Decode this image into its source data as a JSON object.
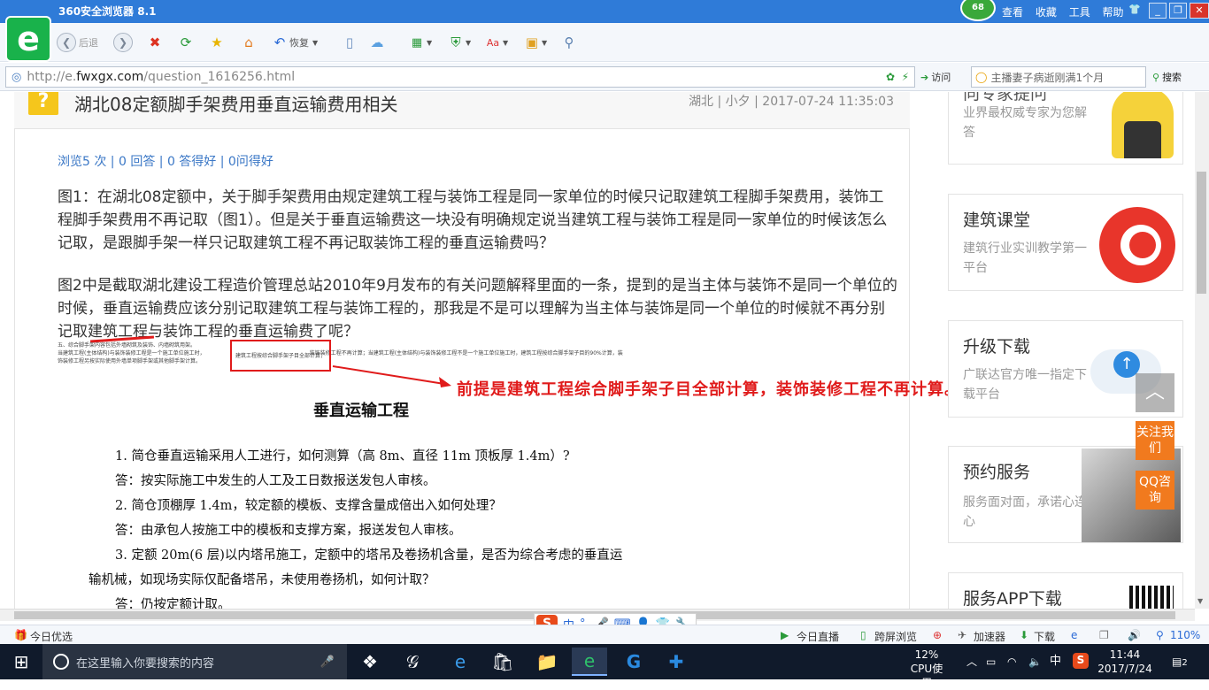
{
  "browser": {
    "title": "360安全浏览器 8.1",
    "score": "68",
    "menus": [
      "查看",
      "收藏",
      "工具",
      "帮助"
    ],
    "back_label": "后退",
    "restore_label": "恢复",
    "url_prefix": "http://e.",
    "url_domain": "fwxgx.com",
    "url_path": "/question_1616256.html",
    "go_label": "访问",
    "search_placeholder": "主播妻子病逝刚满1个月",
    "search_label": "搜索"
  },
  "question": {
    "title": "湖北08定额脚手架费用垂直运输费用相关",
    "meta": "湖北 | 小夕 | 2017-07-24 11:35:03",
    "stats": "浏览5 次 | 0 回答 | 0 答得好 | 0问得好",
    "para1": "图1：在湖北08定额中，关于脚手架费用由规定建筑工程与装饰工程是同一家单位的时候只记取建筑工程脚手架费用，装饰工程脚手架费用不再记取（图1）。但是关于垂直运输费这一块没有明确规定说当建筑工程与装饰工程是同一家单位的时候该怎么记取，是跟脚手架一样只记取建筑工程不再记取装饰工程的垂直运输费吗？",
    "para2": "图2中是截取湖北建设工程造价管理总站2010年9月发布的有关问题解释里面的一条，提到的是当主体与装饰不是同一个单位的时候，垂直运输费应该分别记取建筑工程与装饰工程的，那我是不是可以理解为当主体与装饰是同一个单位的时候就不再分别记取建筑工程与装饰工程的垂直运输费了呢？"
  },
  "doc_image": {
    "line1": "五、综合脚手架内容包括外墙砌筑及装饰、内墙砌筑用架。",
    "line2": "当建筑工程(主体结构)与装饰装修工程是一个施工单位施工时，",
    "boxed": "建筑工程按综合脚手架子目全部计算，",
    "line2b": "装饰装修工程不再计算；当建筑工程(主体结构)与装饰装修工程不是一个施工单位施工时，建筑工程按综合脚手架子目的90%计算，装",
    "line3": "饰装修工程另按实际使用外墙单项脚手架或其他脚手架计算。",
    "annotation": "前提是建筑工程综合脚手架子目全部计算，装饰装修工程不再计算。",
    "section_title": "垂直运输工程",
    "q1": "1. 简仓垂直运输采用人工进行，如何测算（高 8m、直径 11m 顶板厚 1.4m）?",
    "a1": "答：按实际施工中发生的人工及工日数报送发包人审核。",
    "q2": "2. 简仓顶棚厚 1.4m，较定额的模板、支撑含量成倍出入如何处理？",
    "a2": "答：由承包人按施工中的模板和支撑方案，报送发包人审核。",
    "q3a": "3. 定额 20m(6 层)以内塔吊施工，定额中的塔吊及卷扬机含量，是否为综合考虑的垂直运",
    "q3b": "输机械，如现场实际仅配备塔吊，未使用卷扬机，如何计取？",
    "a3": "答：仍按定额计取。"
  },
  "sidebar": {
    "ask_line": "向专家提问",
    "ask_desc": "业界最权威专家为您解答",
    "course_title": "建筑课堂",
    "course_desc": "建筑行业实训教学第一平台",
    "download_title": "升级下载",
    "download_desc": "广联达官方唯一指定下载平台",
    "service_title": "预约服务",
    "service_desc": "服务面对面，承诺心连心",
    "app_title": "服务APP下载",
    "follow_label": "关注我们",
    "qq_label": "QQ咨询",
    "back_top": "︿"
  },
  "ime": {
    "logo": "S",
    "mode": "中"
  },
  "statusbar": {
    "left": "今日优选",
    "live": "今日直播",
    "cross": "跨屏浏览",
    "accel": "加速器",
    "download": "下载",
    "zoom": "110%"
  },
  "taskbar": {
    "search_placeholder": "在这里输入你要搜索的内容",
    "cpu_pct": "12%",
    "cpu_label": "CPU使用",
    "ime": "中",
    "time": "11:44",
    "date": "2017/7/24",
    "notif_count": "2"
  },
  "colors": {
    "titlebar": "#2f7bd8",
    "accent_red": "#e01b1b",
    "link_blue": "#3a77c6",
    "orange": "#f17a1e"
  }
}
